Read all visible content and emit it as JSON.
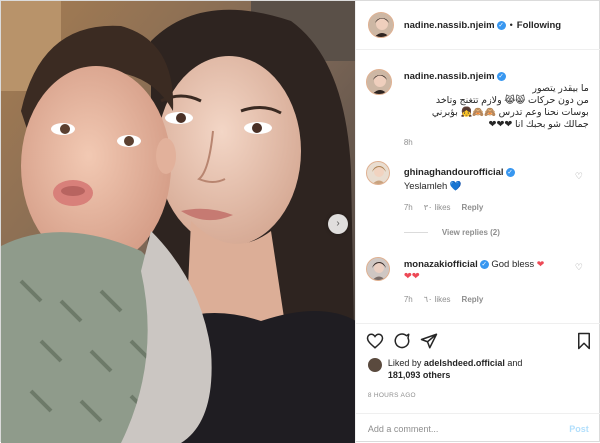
{
  "header": {
    "username": "nadine.nassib.njeim",
    "separator": "•",
    "follow_state": "Following",
    "more_icon": "ellipsis-icon"
  },
  "caption": {
    "username": "nadine.nassib.njeim",
    "lines": [
      "ما بيقدر يتصور",
      "من دون حركات 😸😹 ولازم تتغنج وتاخد",
      "بوسات نحنا وعم تدرس 🙈🙈👧 بؤبرني",
      "جمالك شو بحبك انا ❤❤❤"
    ],
    "time": "8h"
  },
  "comments": [
    {
      "username": "ghinaghandourofficial",
      "text": "Yeslamleh 💙",
      "time": "7h",
      "likes": "٣٠ likes",
      "reply": "Reply",
      "view_replies": "View replies (2)"
    },
    {
      "username": "monazakiofficial",
      "text": "God bless",
      "hearts": "❤❤",
      "time": "7h",
      "likes": "٦٠ likes",
      "reply": "Reply"
    }
  ],
  "actions": {
    "icons": [
      "heart-outline-icon",
      "comment-icon",
      "share-icon",
      "bookmark-icon"
    ]
  },
  "likes": {
    "prefix": "Liked by",
    "user": "adelshdeed.official",
    "conj": "and",
    "count": "181,093 others"
  },
  "posted": "8 HOURS AGO",
  "add_comment": {
    "placeholder": "Add a comment...",
    "post_label": "Post"
  },
  "colors": {
    "verified": "#3897f0",
    "heart": "#ed4956",
    "post_button_disabled": "#b2dffc",
    "meta_gray": "#8e8e8e"
  }
}
